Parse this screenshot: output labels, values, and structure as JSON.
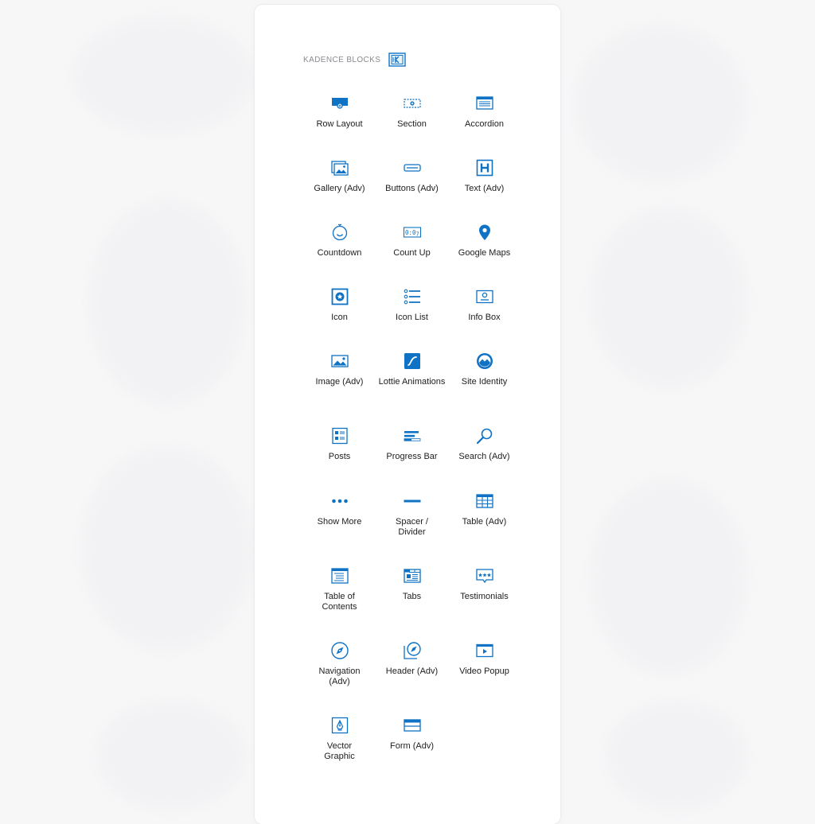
{
  "panel": {
    "title": "KADENCE BLOCKS",
    "brand_icon": "kadence-logo-icon",
    "accent_color": "#0f72c4"
  },
  "blocks": [
    {
      "label": "Row Layout",
      "icon": "row-layout-icon"
    },
    {
      "label": "Section",
      "icon": "section-icon"
    },
    {
      "label": "Accordion",
      "icon": "accordion-icon"
    },
    {
      "label": "Gallery (Adv)",
      "icon": "gallery-icon"
    },
    {
      "label": "Buttons (Adv)",
      "icon": "buttons-icon"
    },
    {
      "label": "Text (Adv)",
      "icon": "text-heading-icon"
    },
    {
      "label": "Countdown",
      "icon": "countdown-icon"
    },
    {
      "label": "Count Up",
      "icon": "count-up-icon"
    },
    {
      "label": "Google Maps",
      "icon": "map-pin-icon"
    },
    {
      "label": "Icon",
      "icon": "icon-block-icon"
    },
    {
      "label": "Icon List",
      "icon": "icon-list-icon"
    },
    {
      "label": "Info Box",
      "icon": "info-box-icon"
    },
    {
      "label": "Image (Adv)",
      "icon": "image-icon"
    },
    {
      "label": "Lottie Animations",
      "icon": "lottie-icon"
    },
    {
      "label": "Site Identity",
      "icon": "site-identity-icon"
    },
    {
      "label": "Posts",
      "icon": "posts-icon"
    },
    {
      "label": "Progress Bar",
      "icon": "progress-bar-icon"
    },
    {
      "label": "Search (Adv)",
      "icon": "search-icon"
    },
    {
      "label": "Show More",
      "icon": "show-more-icon"
    },
    {
      "label": "Spacer / Divider",
      "icon": "spacer-divider-icon"
    },
    {
      "label": "Table (Adv)",
      "icon": "table-icon"
    },
    {
      "label": "Table of Contents",
      "icon": "table-of-contents-icon"
    },
    {
      "label": "Tabs",
      "icon": "tabs-icon"
    },
    {
      "label": "Testimonials",
      "icon": "testimonials-icon"
    },
    {
      "label": "Navigation (Adv)",
      "icon": "navigation-icon"
    },
    {
      "label": "Header (Adv)",
      "icon": "header-icon"
    },
    {
      "label": "Video Popup",
      "icon": "video-popup-icon"
    },
    {
      "label": "Vector Graphic",
      "icon": "vector-graphic-icon"
    },
    {
      "label": "Form (Adv)",
      "icon": "form-icon"
    }
  ]
}
